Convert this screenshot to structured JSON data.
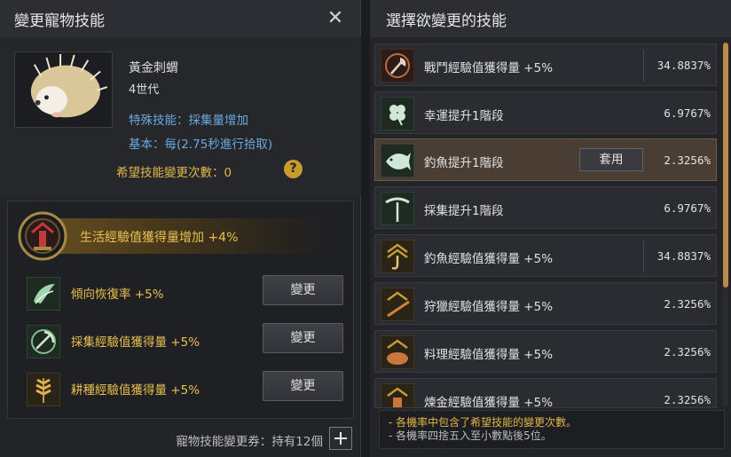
{
  "left": {
    "title": "變更寵物技能",
    "pet": {
      "name": "黃金刺蝟",
      "generation": "4世代",
      "special": "特殊技能：採集量增加",
      "basic": "基本：每(2.75秒進行拾取)"
    },
    "wish_count": "希望技能變更次數：0",
    "help_icon_text": "?",
    "main_skill": "生活經驗值獲得量增加 +4%",
    "skills": [
      {
        "label": "傾向恢復率 +5%",
        "button": "變更",
        "icon": "wing-icon"
      },
      {
        "label": "採集經驗值獲得量 +5%",
        "button": "變更",
        "icon": "pickaxe-icon"
      },
      {
        "label": "耕種經驗值獲得量 +5%",
        "button": "變更",
        "icon": "wheat-icon"
      }
    ],
    "ticket": "寵物技能變更券：持有12個"
  },
  "right": {
    "title": "選擇欲變更的技能",
    "options": [
      {
        "label": "戰鬥經驗值獲得量 +5%",
        "pct": "34.8837%",
        "icon": "axe-icon"
      },
      {
        "label": "幸運提升1階段",
        "pct": "6.9767%",
        "icon": "clover-icon"
      },
      {
        "label": "釣魚提升1階段",
        "pct": "2.3256%",
        "icon": "fish-icon",
        "selected": true,
        "apply": "套用"
      },
      {
        "label": "採集提升1階段",
        "pct": "6.9767%",
        "icon": "pickaxe-icon"
      },
      {
        "label": "釣魚經驗值獲得量 +5%",
        "pct": "34.8837%",
        "icon": "hook-icon"
      },
      {
        "label": "狩獵經驗值獲得量 +5%",
        "pct": "2.3256%",
        "icon": "rifle-icon"
      },
      {
        "label": "料理經驗值獲得量 +5%",
        "pct": "2.3256%",
        "icon": "cooking-icon"
      },
      {
        "label": "煉金經驗值獲得量 +5%",
        "pct": "2.3256%",
        "icon": "alchemy-icon"
      }
    ],
    "notes": [
      "- 各機率中包含了希望技能的變更次數。",
      "- 各機率四捨五入至小數點後5位。"
    ]
  },
  "colors": {
    "accent": "#e8c050",
    "blue_text": "#6aa8de",
    "selected_row": "#4a3e34",
    "scroll_thumb": "#b88b4a"
  }
}
